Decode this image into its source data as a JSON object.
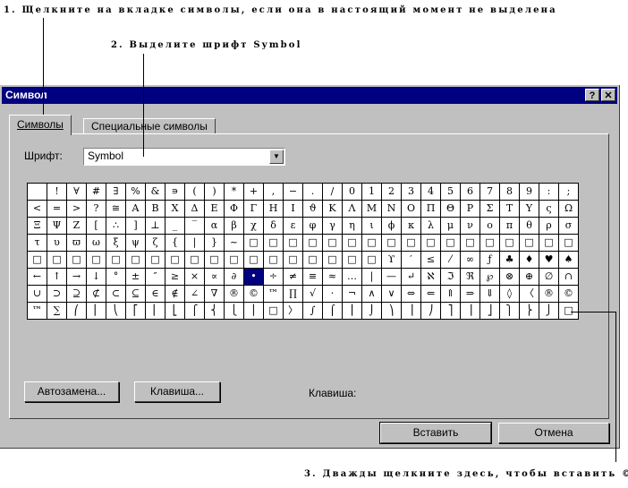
{
  "callouts": {
    "step1": "1. Щелкните на вкладке символы, если она в настоящий момент не выделена",
    "step2": "2. Выделите шрифт Symbol",
    "step3": "3. Дважды щелкните здесь, чтобы вставить ©"
  },
  "dialog": {
    "title": "Символ",
    "help_glyph": "?",
    "close_glyph": "✕",
    "tabs": [
      "Символы",
      "Специальные символы"
    ],
    "font_label": "Шрифт:",
    "font_value": "Symbol",
    "dropdown_glyph": "▼",
    "key_label": "Клавиша:",
    "buttons": {
      "autocorrect": "Автозамена...",
      "shortcut": "Клавиша...",
      "insert": "Вставить",
      "cancel": "Отмена"
    }
  },
  "grid": {
    "selected_cell": "•",
    "rows": [
      [
        " ",
        "!",
        "∀",
        "#",
        "∃",
        "%",
        "&",
        "∍",
        "(",
        ")",
        "*",
        "+",
        ",",
        "−",
        ".",
        "/",
        "0",
        "1",
        "2",
        "3",
        "4",
        "5",
        "6",
        "7",
        "8",
        "9",
        ":",
        ";"
      ],
      [
        "<",
        "=",
        ">",
        "?",
        "≅",
        "Α",
        "Β",
        "Χ",
        "Δ",
        "Ε",
        "Φ",
        "Γ",
        "Η",
        "Ι",
        "ϑ",
        "Κ",
        "Λ",
        "Μ",
        "Ν",
        "Ο",
        "Π",
        "Θ",
        "Ρ",
        "Σ",
        "Τ",
        "Υ",
        "ς",
        "Ω"
      ],
      [
        "Ξ",
        "Ψ",
        "Ζ",
        "[",
        "∴",
        "]",
        "⊥",
        "_",
        "‾",
        "α",
        "β",
        "χ",
        "δ",
        "ε",
        "φ",
        "γ",
        "η",
        "ι",
        "ϕ",
        "κ",
        "λ",
        "μ",
        "ν",
        "ο",
        "π",
        "θ",
        "ρ",
        "σ"
      ],
      [
        "τ",
        "υ",
        "ϖ",
        "ω",
        "ξ",
        "ψ",
        "ζ",
        "{",
        "|",
        "}",
        "~",
        "□",
        "□",
        "□",
        "□",
        "□",
        "□",
        "□",
        "□",
        "□",
        "□",
        "□",
        "□",
        "□",
        "□",
        "□",
        "□",
        "□"
      ],
      [
        "□",
        "□",
        "□",
        "□",
        "□",
        "□",
        "□",
        "□",
        "□",
        "□",
        "□",
        "□",
        "□",
        "□",
        "□",
        "□",
        "□",
        "□",
        "ϒ",
        "′",
        "≤",
        "⁄",
        "∞",
        "ƒ",
        "♣",
        "♦",
        "♥",
        "♠",
        "↔"
      ],
      [
        "←",
        "↑",
        "→",
        "↓",
        "°",
        "±",
        "″",
        "≥",
        "×",
        "∝",
        "∂",
        "•",
        "÷",
        "≠",
        "≡",
        "≈",
        "…",
        "|",
        "—",
        "↵",
        "ℵ",
        "ℑ",
        "ℜ",
        "℘",
        "⊗",
        "⊕",
        "∅",
        "∩"
      ],
      [
        "∪",
        "⊃",
        "⊇",
        "⊄",
        "⊂",
        "⊆",
        "∈",
        "∉",
        "∠",
        "∇",
        "®",
        "©",
        "™",
        "∏",
        "√",
        "⋅",
        "¬",
        "∧",
        "∨",
        "⇔",
        "⇐",
        "⇑",
        "⇒",
        "⇓",
        "◊",
        "〈",
        "®",
        "©"
      ],
      [
        "™",
        "∑",
        "⎛",
        "⎜",
        "⎝",
        "⎡",
        "⎢",
        "⎣",
        "⎧",
        "⎨",
        "⎩",
        "⎪",
        "□",
        "〉",
        "∫",
        "⌠",
        "⎮",
        "⌡",
        "⎞",
        "⎟",
        "⎠",
        "⎤",
        "⎥",
        "⎦",
        "⎫",
        "⎬",
        "⎭",
        "□"
      ]
    ]
  }
}
